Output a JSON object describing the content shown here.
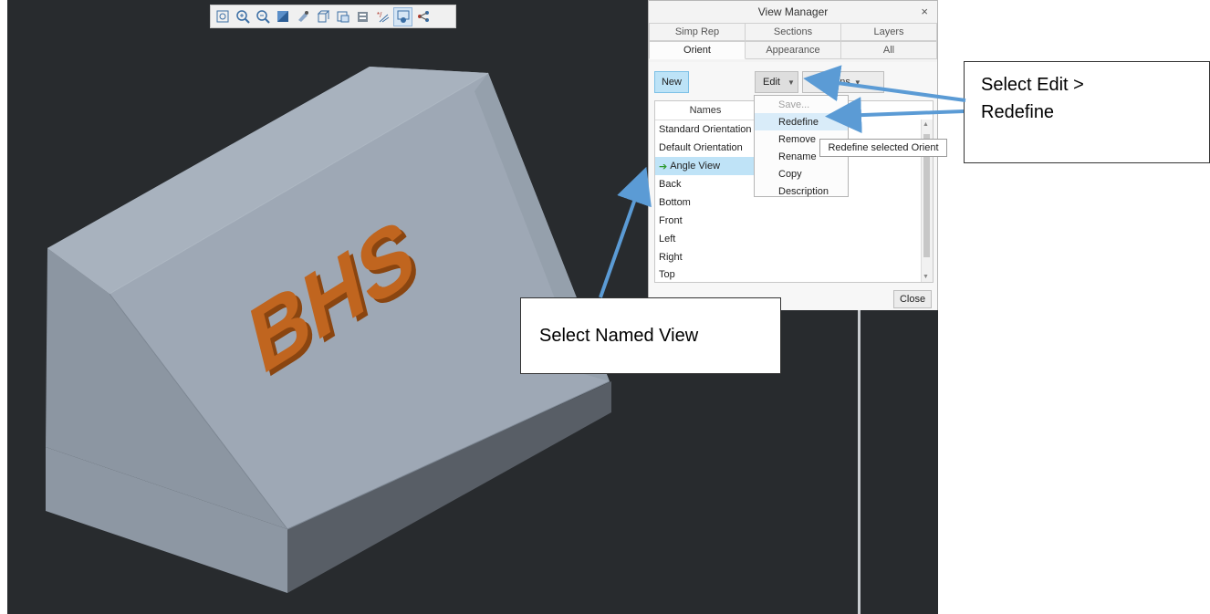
{
  "dialog": {
    "title": "View Manager",
    "close_glyph": "×",
    "tabs_row1": [
      "Simp Rep",
      "Sections",
      "Layers"
    ],
    "tabs_row2": [
      "Orient",
      "Appearance",
      "All"
    ],
    "active_tab": "Orient",
    "buttons": {
      "new": "New",
      "edit": "Edit",
      "options": "Options",
      "close": "Close"
    },
    "list_header": "Names",
    "names": [
      "Standard Orientation",
      "Default Orientation",
      "Angle View",
      "Back",
      "Bottom",
      "Front",
      "Left",
      "Right",
      "Top"
    ],
    "selected": "Angle View"
  },
  "edit_menu": {
    "items": [
      "Save...",
      "Redefine",
      "Remove",
      "Rename",
      "Copy",
      "Description"
    ],
    "disabled": "Save...",
    "highlighted": "Redefine",
    "tooltip": "Redefine selected Orient"
  },
  "callouts": {
    "named_view": "Select Named View",
    "edit_line1": "Select Edit >",
    "edit_line2": "Redefine"
  },
  "model": {
    "embossed_text": "BHS",
    "text_color": "#c0651f",
    "block_color": "#9ea8b5"
  },
  "toolbar": {
    "icons": [
      "refit-icon",
      "zoom-in-icon",
      "zoom-out-icon",
      "repaint-icon",
      "display-style-icon",
      "named-views-icon",
      "saved-orientations-icon",
      "view-manager-icon",
      "datum-display-icon",
      "spin-center-icon",
      "annotation-display-icon"
    ]
  },
  "colors": {
    "viewport_bg": "#282b2e",
    "callout_arrow": "#5b9bd5",
    "selection_bg": "#bfe3f7"
  }
}
